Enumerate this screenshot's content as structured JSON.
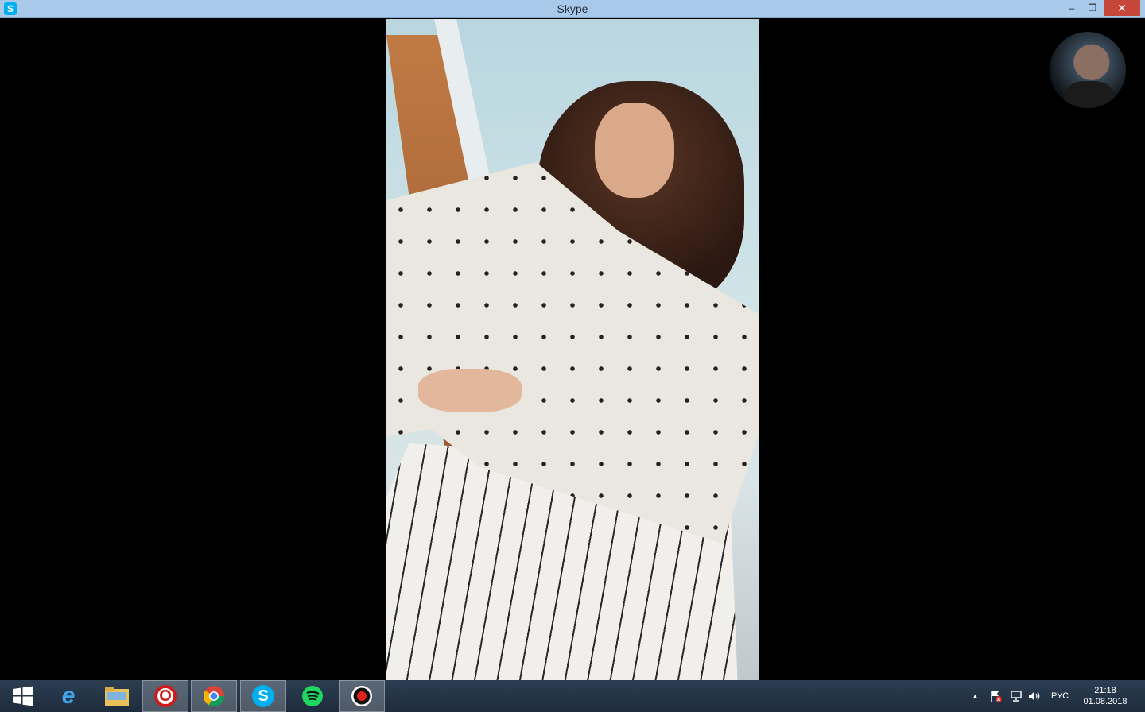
{
  "window": {
    "title": "Skype",
    "app_icon_letter": "S",
    "controls": {
      "minimize": "–",
      "maximize": "❐",
      "close": "✕"
    }
  },
  "taskbar": {
    "apps": [
      {
        "name": "start",
        "icon": "windows-logo-icon"
      },
      {
        "name": "internet-explorer",
        "icon": "ie-icon",
        "glyph": "e"
      },
      {
        "name": "file-explorer",
        "icon": "folder-icon"
      },
      {
        "name": "opera",
        "icon": "opera-icon",
        "glyph": "O"
      },
      {
        "name": "chrome",
        "icon": "chrome-icon"
      },
      {
        "name": "skype",
        "icon": "skype-icon",
        "glyph": "S"
      },
      {
        "name": "spotify",
        "icon": "spotify-icon"
      },
      {
        "name": "recorder",
        "icon": "record-icon"
      }
    ],
    "tray": {
      "arrow": "▲",
      "language": "РУС",
      "time": "21:18",
      "date": "01.08.2018"
    }
  }
}
